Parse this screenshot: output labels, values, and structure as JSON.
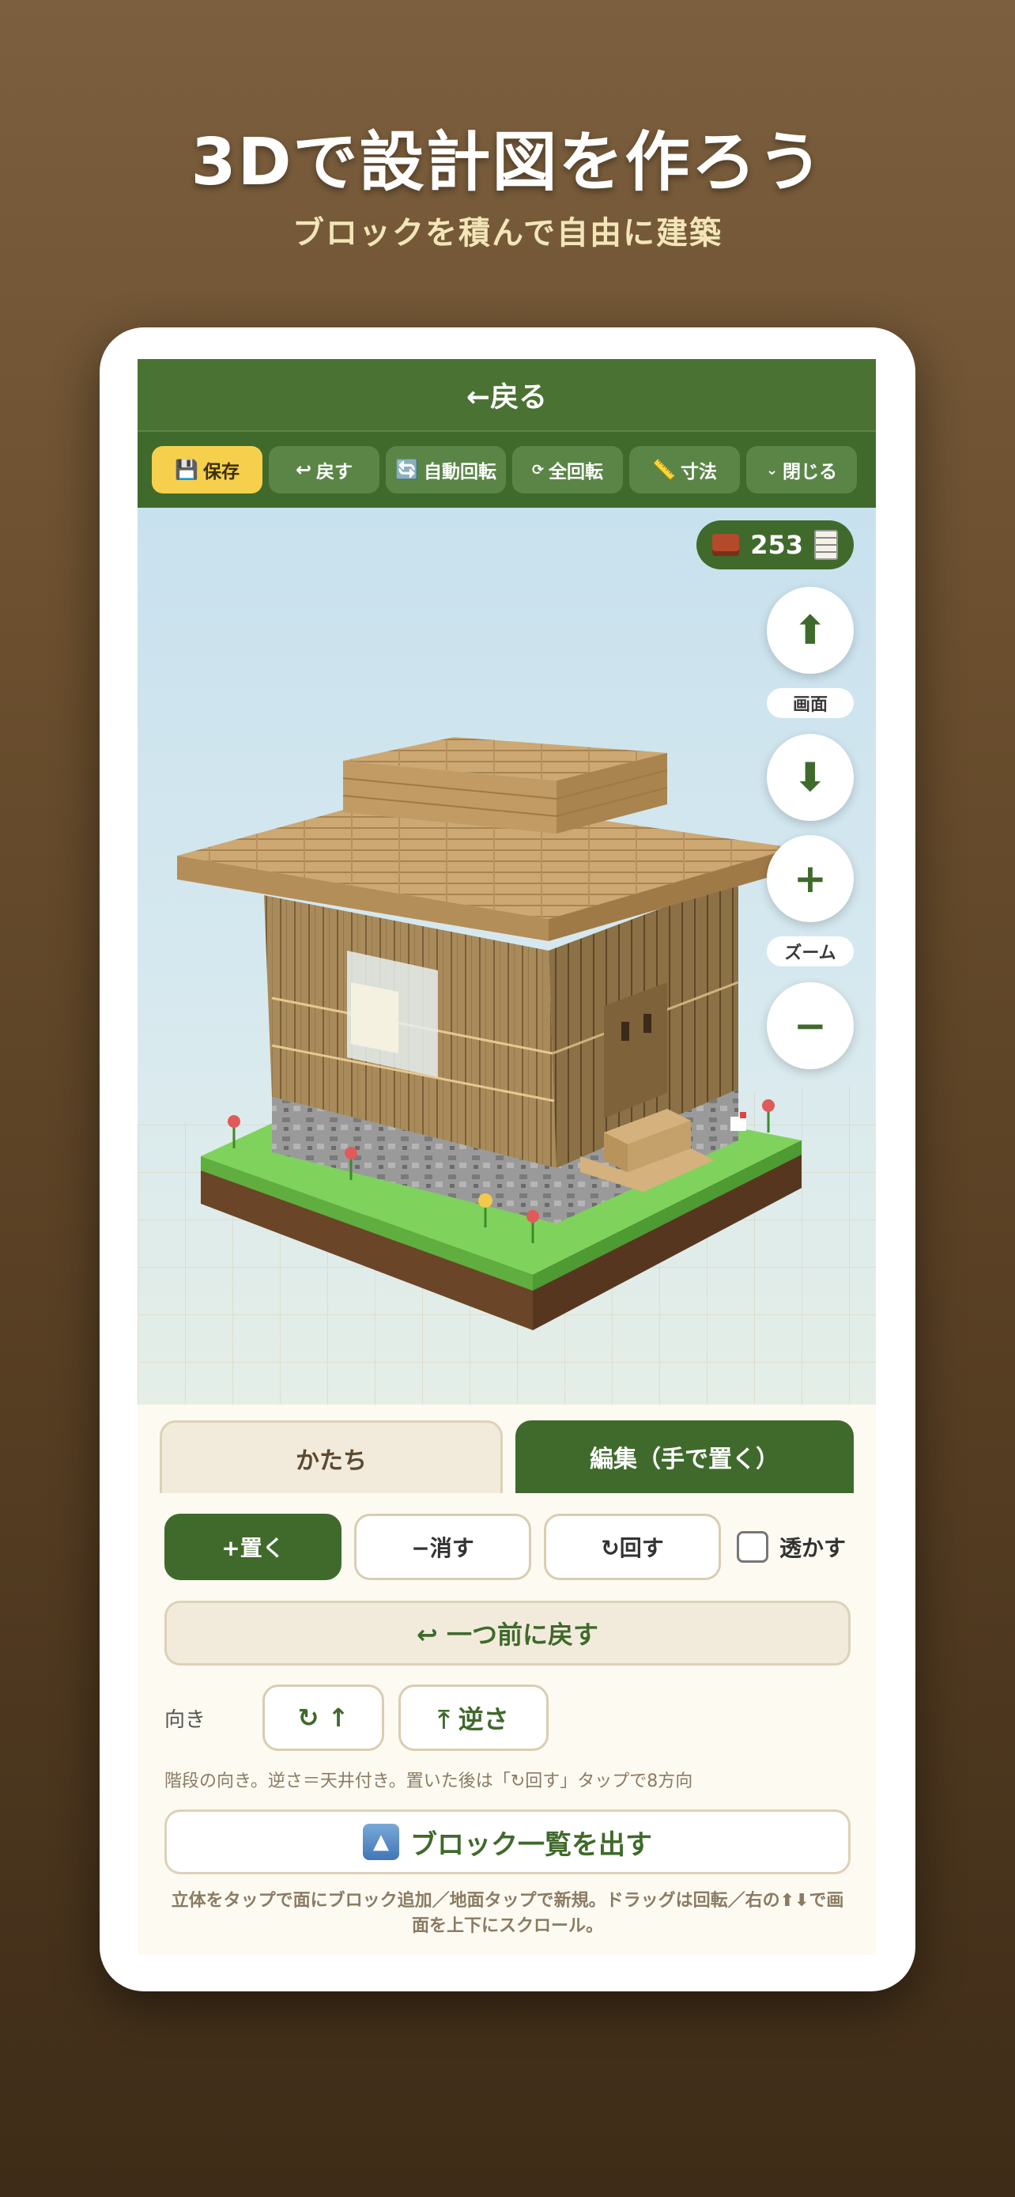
{
  "hero": {
    "title": "3Dで設計図を作ろう",
    "subtitle": "ブロックを積んで自由に建築"
  },
  "header": {
    "back_label": "←戻る"
  },
  "toolbar": {
    "save": "保存",
    "undo": "戻す",
    "auto_rotate": "自動回転",
    "full_rotate": "全回転",
    "dimensions": "寸法",
    "close": "閉じる"
  },
  "counter": {
    "value": "253"
  },
  "view_controls": {
    "screen_label": "画面",
    "zoom_label": "ズーム",
    "up": "⬆",
    "down": "⬇",
    "zoom_in": "+",
    "zoom_out": "−"
  },
  "tabs": {
    "shape": "かたち",
    "edit": "編集（手で置く）"
  },
  "actions": {
    "place": "+置く",
    "erase": "−消す",
    "rotate": "↻回す",
    "transparent": "透かす"
  },
  "undo_step": "↩ 一つ前に戻す",
  "orientation": {
    "label": "向き",
    "btn1": "↻ ↑",
    "btn2": "⤒ 逆さ"
  },
  "hint_stairs": "階段の向き。逆さ＝天井付き。置いた後は「↻回す」タップで8方向",
  "block_list": "ブロック一覧を出す",
  "hint_bottom": "立体をタップで面にブロック追加／地面タップで新規。ドラッグは回転／右の⬆⬇で画面を上下にスクロール。",
  "colors": {
    "primary": "#3f6a2b",
    "accent": "#f6d04d",
    "cream": "#f2ebdc"
  }
}
